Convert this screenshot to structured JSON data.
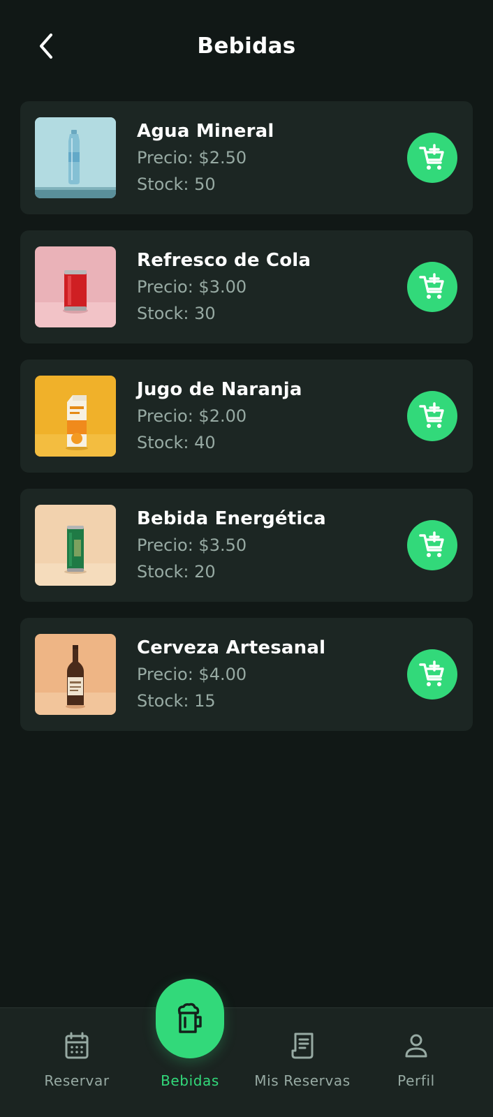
{
  "header": {
    "title": "Bebidas",
    "back_icon": "chevron-left-icon"
  },
  "products": [
    {
      "name": "Agua Mineral",
      "price": "Precio: $2.50",
      "stock": "Stock: 50",
      "image": "water-bottle",
      "bg": "#a6d1d8"
    },
    {
      "name": "Refresco de Cola",
      "price": "Precio: $3.00",
      "stock": "Stock: 30",
      "image": "cola-can",
      "bg": "#eab2b8"
    },
    {
      "name": "Jugo de Naranja",
      "price": "Precio: $2.00",
      "stock": "Stock: 40",
      "image": "orange-juice-carton",
      "bg": "#f0b12a"
    },
    {
      "name": "Bebida Energética",
      "price": "Precio: $3.50",
      "stock": "Stock: 20",
      "image": "energy-drink-can",
      "bg": "#f2d2ae"
    },
    {
      "name": "Cerveza Artesanal",
      "price": "Precio: $4.00",
      "stock": "Stock: 15",
      "image": "beer-bottle",
      "bg": "#eeb585"
    }
  ],
  "add_button_icon": "add-to-cart-icon",
  "nav": {
    "items": [
      {
        "label": "Reservar",
        "icon": "calendar-icon"
      },
      {
        "label": "Bebidas",
        "icon": "beer-mug-icon",
        "active": true
      },
      {
        "label": "Mis Reservas",
        "icon": "receipt-icon"
      },
      {
        "label": "Perfil",
        "icon": "person-icon"
      }
    ]
  },
  "colors": {
    "background": "#111816",
    "card": "#1c2623",
    "accent": "#32d97a",
    "muted_text": "#97aaa3"
  }
}
